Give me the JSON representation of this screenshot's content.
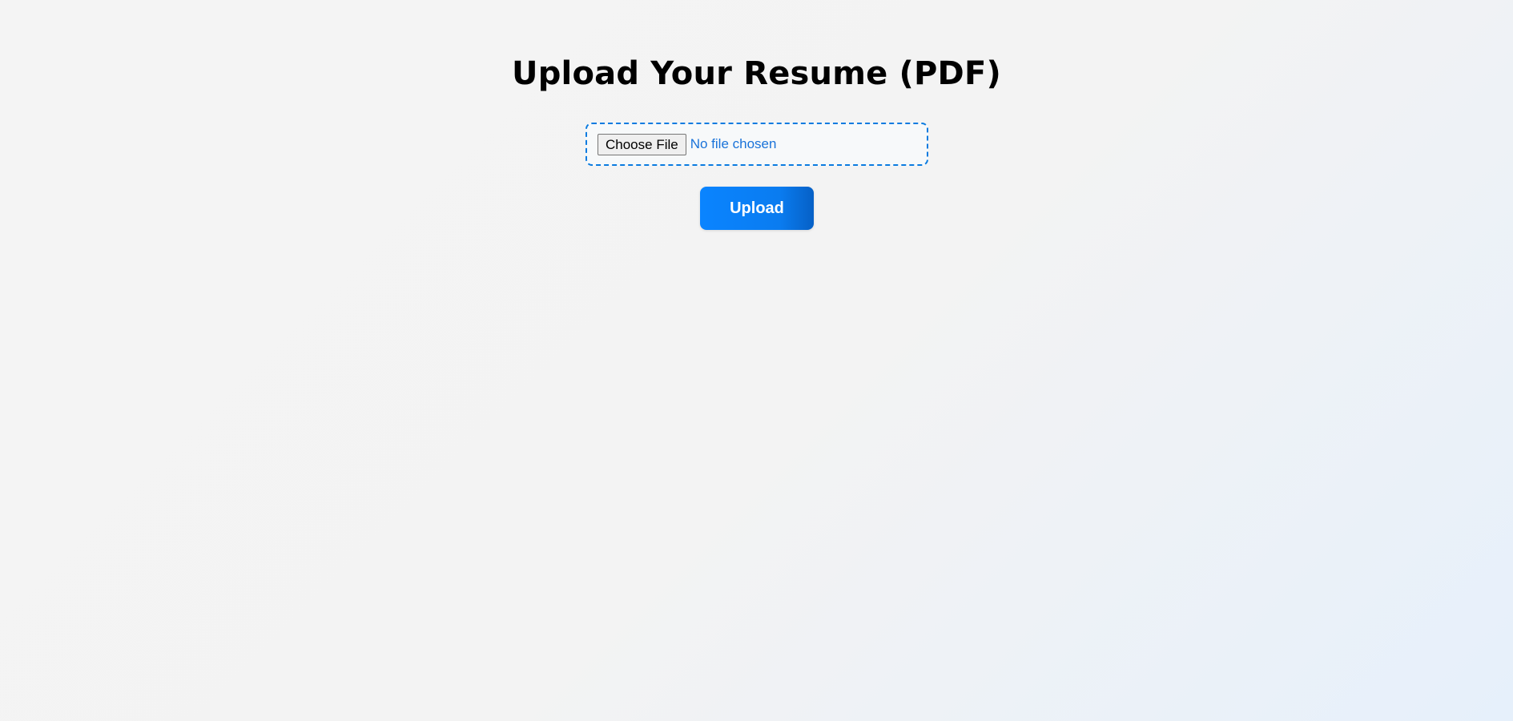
{
  "page": {
    "title": "Upload Your Resume (PDF)"
  },
  "file_input": {
    "button_label": "Choose File",
    "status_text": "No file chosen",
    "border_color": "#0a7be0",
    "status_color": "#1a73d9"
  },
  "upload": {
    "button_label": "Upload",
    "accent_color": "#0a84ff"
  }
}
